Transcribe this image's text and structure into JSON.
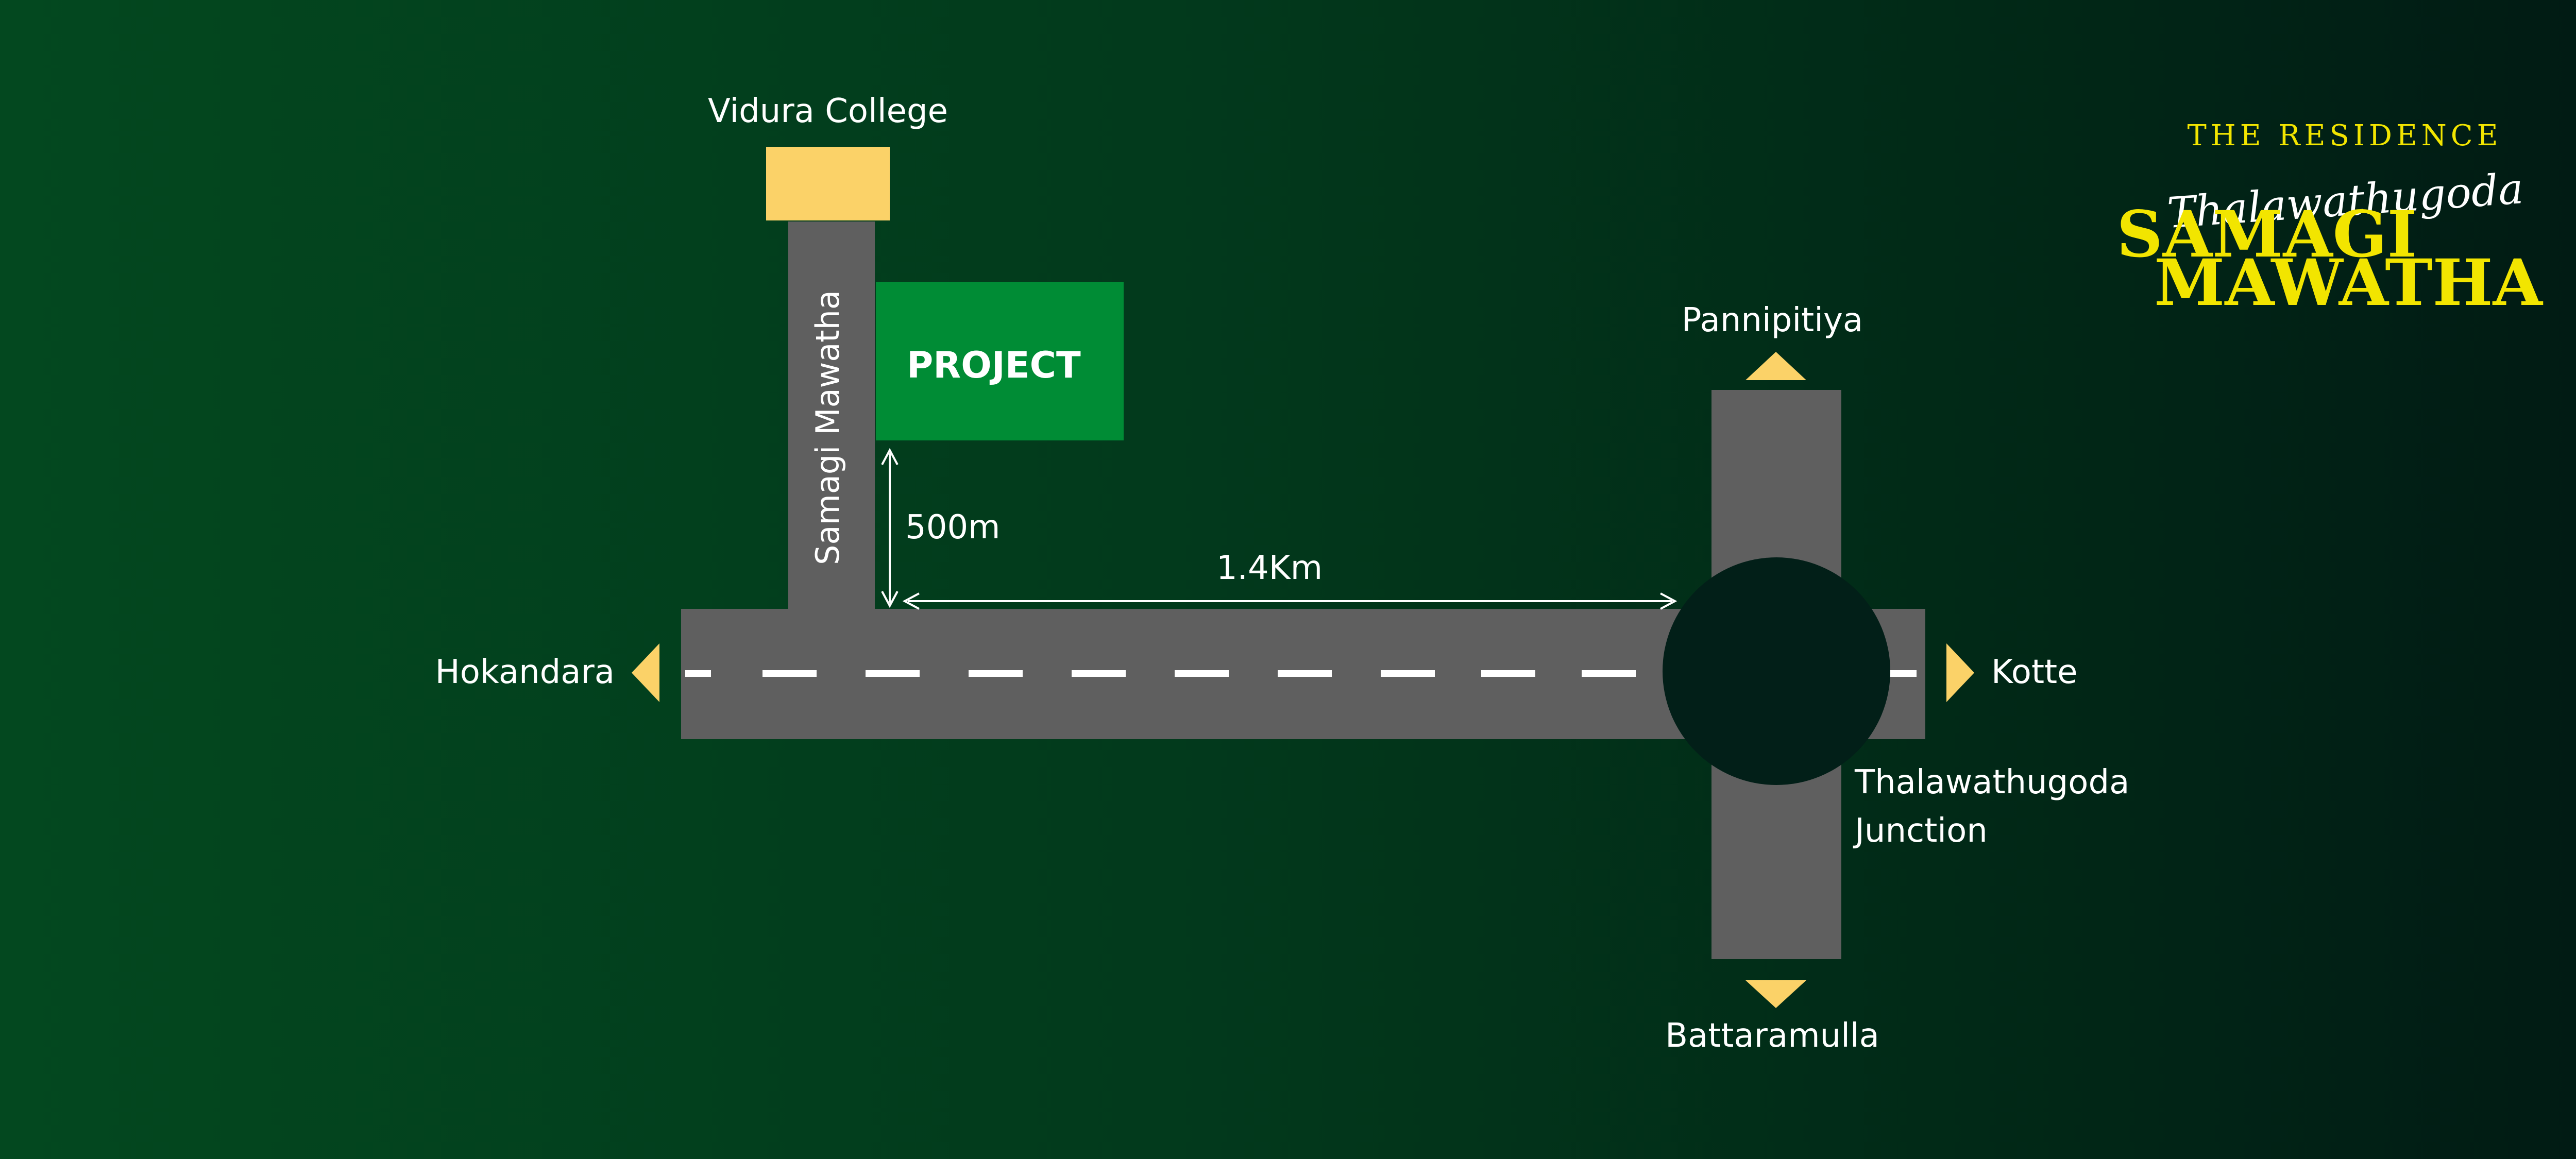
{
  "places": {
    "vidura_college": "Vidura College",
    "project": "PROJECT",
    "pannipitiya": "Pannipitiya",
    "hokandara": "Hokandara",
    "kotte": "Kotte",
    "battaramulla": "Battaramulla",
    "junction_line1": "Thalawathugoda",
    "junction_line2": "Junction"
  },
  "roads": {
    "samagi_mawatha": "Samagi Mawatha"
  },
  "distances": {
    "to_main_road": "500m",
    "to_junction": "1.4Km"
  },
  "brand": {
    "line1": "THE RESIDENCE",
    "line2": "Thalawathugoda",
    "line3": "SAMAGI",
    "line4": "MAWATHA"
  },
  "colors": {
    "road": "#5f5f5f",
    "marker": "#fbd268",
    "project": "#008c35",
    "roundabout": "#021f18",
    "brand_yellow": "#f2e500"
  }
}
